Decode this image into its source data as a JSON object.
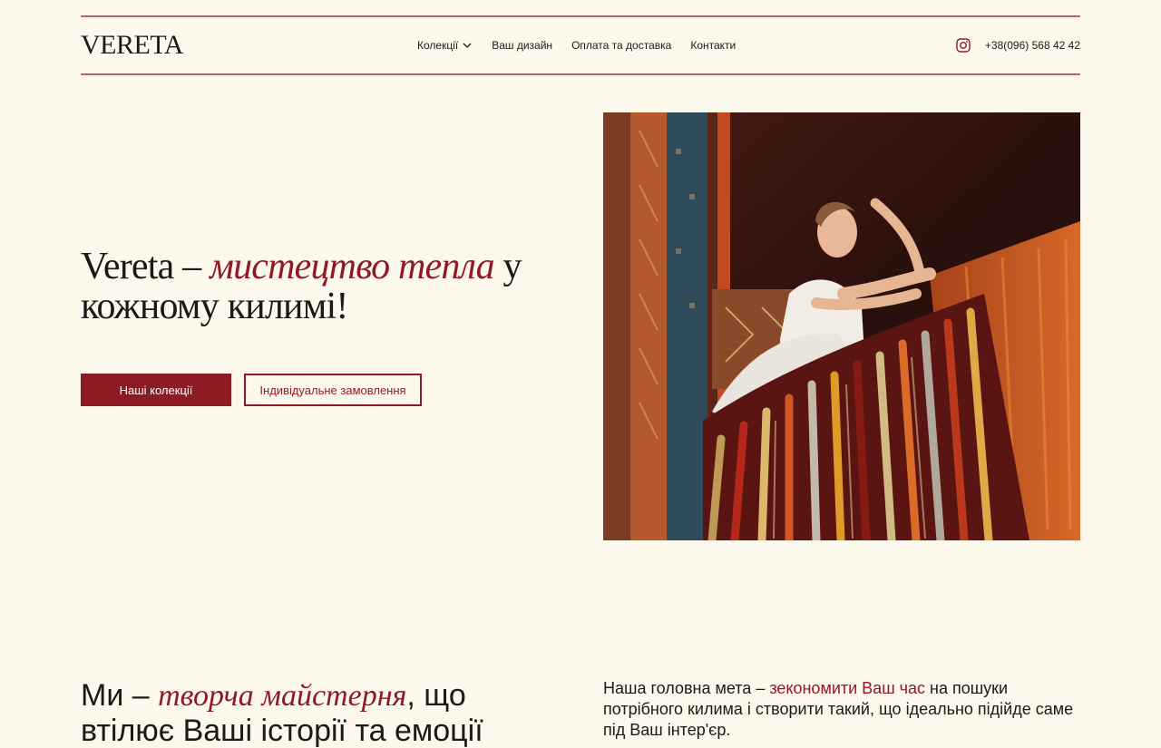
{
  "header": {
    "logo": "VERETA",
    "nav": [
      {
        "label": "Колекції",
        "dropdown": true
      },
      {
        "label": "Ваш дизайн"
      },
      {
        "label": "Оплата та доставка"
      },
      {
        "label": "Контакти"
      }
    ],
    "phone": "+38(096) 568 42 42",
    "social_icon": "instagram-icon"
  },
  "hero": {
    "title_part1": "Vereta – ",
    "title_accent": "мистецтво тепла",
    "title_part2": " у кожному килимі!",
    "primary_button": "Наші колекції",
    "secondary_button": "Індивідуальне замовлення"
  },
  "about": {
    "title_part1": "Ми – ",
    "title_accent": "творча майстерня",
    "title_part2": ", що втілює Ваші історії та емоції",
    "text_part1": "Наша головна мета – ",
    "text_accent": "зекономити Ваш час",
    "text_part2": " на пошуки потрібного килима і створити такий, що ідеально підійде саме під Ваш інтер'єр."
  },
  "colors": {
    "background": "#fdf8ec",
    "accent": "#8e1a24",
    "divider": "#b7616a",
    "text": "#1c1a17"
  }
}
